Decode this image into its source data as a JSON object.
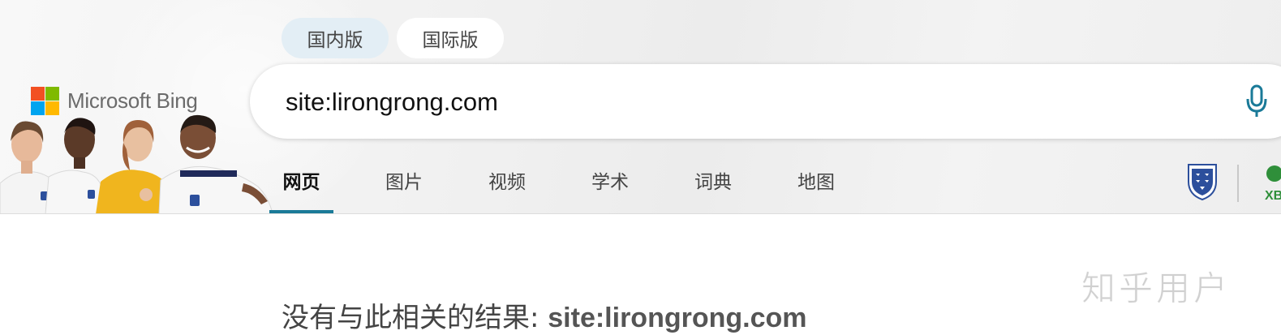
{
  "lang_tabs": [
    {
      "label": "国内版",
      "selected": true
    },
    {
      "label": "国际版",
      "selected": false
    }
  ],
  "logo": {
    "text": "Microsoft Bing",
    "colors": [
      "#f25022",
      "#7fba00",
      "#00a4ef",
      "#ffb900"
    ]
  },
  "search": {
    "value": "site:lirongrong.com"
  },
  "nav": {
    "items": [
      "网页",
      "图片",
      "视频",
      "学术",
      "词典",
      "地图"
    ],
    "active_index": 0,
    "accent": "#1a7a98"
  },
  "right_icons": [
    "england-crest-icon",
    "xbox-icon"
  ],
  "results": {
    "message": "没有与此相关的结果: ",
    "query": "site:lirongrong.com"
  },
  "watermark": "知乎用户"
}
